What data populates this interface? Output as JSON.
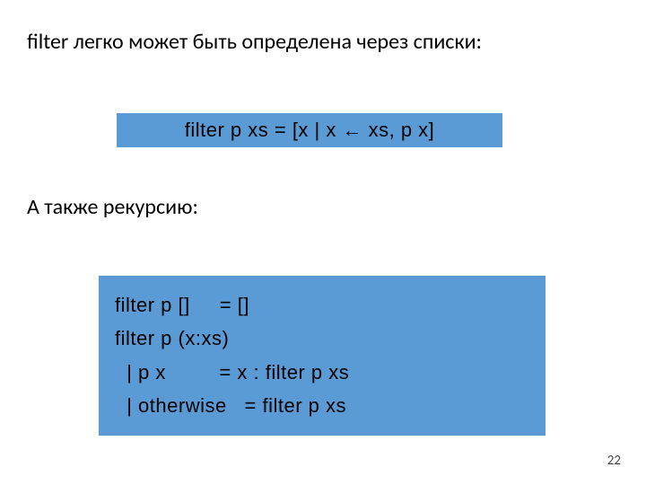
{
  "heading1": "filter легко может быть определена через списки:",
  "code1": "filter p xs = [x | x ← xs, p x]",
  "heading2": "А также рекурсию:",
  "code2": {
    "l1": "filter p []     = []",
    "l2": "filter p (x:xs)",
    "l3": "  | p x         = x : filter p xs",
    "l4": "  | otherwise   = filter p xs"
  },
  "page_number": "22"
}
